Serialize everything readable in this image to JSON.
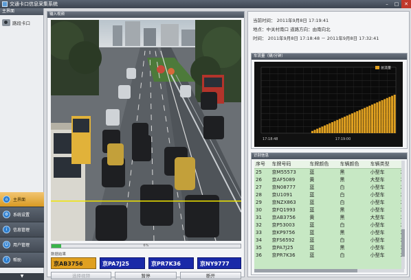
{
  "window": {
    "title": "交通卡口信息采集系统",
    "colors": {
      "titlebar": "#4a525d",
      "accent": "#e0a020",
      "close": "#c0392b"
    }
  },
  "sidebar": {
    "header": "主界面",
    "camera_entry": "路段卡口",
    "nav": [
      {
        "label": "主界面",
        "icon": "home-icon",
        "active": true
      },
      {
        "label": "系统设置",
        "icon": "settings-icon",
        "active": false
      },
      {
        "label": "信息管理",
        "icon": "info-icon",
        "active": false
      },
      {
        "label": "用户管理",
        "icon": "user-icon",
        "active": false
      },
      {
        "label": "帮助",
        "icon": "help-icon",
        "active": false
      }
    ],
    "collapse": "▼"
  },
  "video": {
    "header": "输入视频",
    "progress_percent": 5,
    "progress_text": "6%",
    "recognition_label": "数据结果"
  },
  "plates": [
    {
      "text": "京AB3756",
      "color": "yellow"
    },
    {
      "text": "京PA7J25",
      "color": "blue"
    },
    {
      "text": "京PR7K36",
      "color": "blue"
    },
    {
      "text": "京NY9777",
      "color": "blue"
    }
  ],
  "controls": {
    "start": "选择视频",
    "pause": "暂停",
    "stop": "断开"
  },
  "info": {
    "current_time": "当前时间：  2011年9月8日 17:19:41",
    "location": "地点：中关村南口     道路方向：由南向北",
    "time_range": "时间：  2011年9月8日 17:18:48  －  2011年9月8日 17:32:41"
  },
  "chart_data": {
    "type": "bar",
    "title": "车流量（辆/分钟）",
    "legend": [
      "总流量"
    ],
    "legend_position": "top-right",
    "x_ticks": [
      "17:18:48",
      "17:19:00"
    ],
    "values": [
      0,
      0,
      0,
      0,
      0,
      0,
      0,
      0,
      0,
      0,
      0,
      0,
      0,
      0,
      0,
      0,
      0,
      0,
      0,
      0,
      2,
      3,
      4,
      5,
      6,
      7,
      8,
      9,
      10,
      11,
      12,
      13,
      14,
      15,
      16,
      17,
      18,
      19,
      20,
      21,
      22,
      23,
      24,
      25,
      26,
      27,
      28,
      29,
      30,
      31,
      32,
      33,
      34,
      35
    ],
    "ylim": [
      0,
      60
    ],
    "bar_color": "#e0a020",
    "grid": true
  },
  "table": {
    "header": "识别信息",
    "columns": [
      "序号",
      "车牌号码",
      "车牌颜色",
      "车辆颜色",
      "车辆类型",
      ""
    ],
    "rows": [
      [
        "25",
        "京M55573",
        "蓝",
        "黑",
        "小型车",
        "2011"
      ],
      [
        "26",
        "京AF5089",
        "黄",
        "黑",
        "大型车",
        "2011"
      ],
      [
        "27",
        "京N08777",
        "蓝",
        "白",
        "小型车",
        "2011"
      ],
      [
        "28",
        "京U1091",
        "蓝",
        "白",
        "小型车",
        "2011"
      ],
      [
        "29",
        "京NZX863",
        "蓝",
        "白",
        "小型车",
        "2011"
      ],
      [
        "30",
        "京FQ1993",
        "蓝",
        "黑",
        "小型车",
        "2011"
      ],
      [
        "31",
        "京AB3756",
        "黄",
        "黑",
        "大型车",
        "2011"
      ],
      [
        "32",
        "京P53003",
        "蓝",
        "白",
        "小型车",
        "2011"
      ],
      [
        "33",
        "京KP9756",
        "蓝",
        "黑",
        "小型车",
        "2011"
      ],
      [
        "34",
        "京FS6592",
        "蓝",
        "白",
        "小型车",
        "2011"
      ],
      [
        "35",
        "京PA7J25",
        "蓝",
        "黑",
        "小型车",
        "2011"
      ],
      [
        "36",
        "京PR7K36",
        "蓝",
        "白",
        "小型车",
        "2011"
      ]
    ]
  }
}
